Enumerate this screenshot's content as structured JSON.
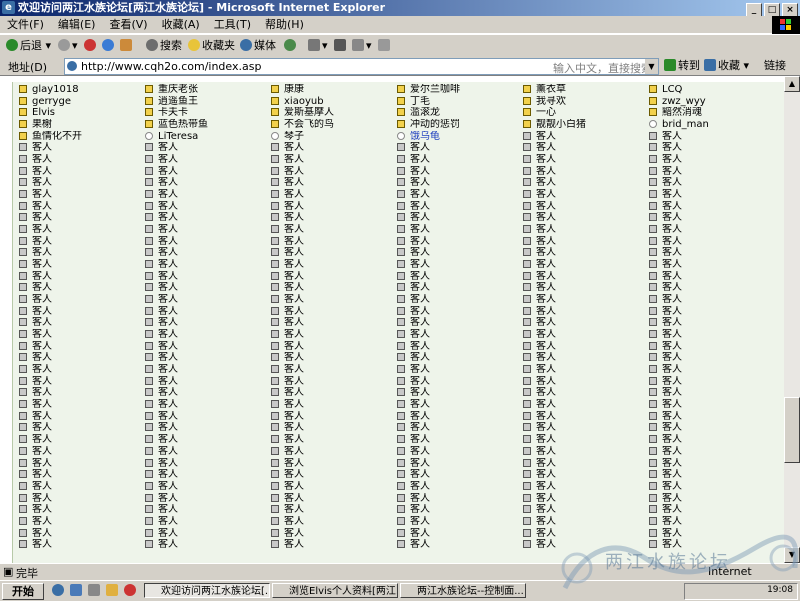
{
  "window": {
    "title": "欢迎访问两江水族论坛[两江水族论坛] - Microsoft Internet Explorer",
    "controls": [
      "_",
      "□",
      "×"
    ]
  },
  "menu": [
    "文件(F)",
    "编辑(E)",
    "查看(V)",
    "收藏(A)",
    "工具(T)",
    "帮助(H)"
  ],
  "toolbar": {
    "back": "后退",
    "search": "搜索",
    "favorites": "收藏夹",
    "media": "媒体"
  },
  "address": {
    "label": "地址(D)",
    "url": "http://www.cqh2o.com/index.asp",
    "search_hint": "输入中文，直接搜索",
    "go": "转到",
    "fav": "收藏",
    "links": "链接"
  },
  "users_named": [
    {
      "name": "glay1018",
      "icon": "member"
    },
    {
      "name": "重庆老张",
      "icon": "member"
    },
    {
      "name": "康康",
      "icon": "member"
    },
    {
      "name": "爱尔兰咖啡",
      "icon": "member"
    },
    {
      "name": "薰衣草",
      "icon": "member"
    },
    {
      "name": "LCQ",
      "icon": "member"
    },
    {
      "name": "gerryge",
      "icon": "member"
    },
    {
      "name": "逍遥鱼王",
      "icon": "member"
    },
    {
      "name": "xiaoyub",
      "icon": "member"
    },
    {
      "name": "丁毛",
      "icon": "member"
    },
    {
      "name": "我寻欢",
      "icon": "member"
    },
    {
      "name": "zwz_wyy",
      "icon": "member"
    },
    {
      "name": "Elvis",
      "icon": "member"
    },
    {
      "name": "卡夫卡",
      "icon": "member"
    },
    {
      "name": "爱斯基摩人",
      "icon": "member"
    },
    {
      "name": "滥滚龙",
      "icon": "member"
    },
    {
      "name": "一心",
      "icon": "member"
    },
    {
      "name": "黯然消魂",
      "icon": "member"
    },
    {
      "name": "果榭",
      "icon": "member"
    },
    {
      "name": "蓝色热带鱼",
      "icon": "member"
    },
    {
      "name": "不会飞的鸟",
      "icon": "member"
    },
    {
      "name": "冲动的惩罚",
      "icon": "member"
    },
    {
      "name": "靓靓小白猪",
      "icon": "member"
    },
    {
      "name": "brid_man",
      "icon": "web"
    },
    {
      "name": "鱼情化不开",
      "icon": "member"
    },
    {
      "name": "LiTeresa",
      "icon": "web"
    },
    {
      "name": "琴子",
      "icon": "web"
    },
    {
      "name": "饿乌龟",
      "icon": "web",
      "highlight": true
    },
    {
      "name": "客人",
      "icon": "guest"
    },
    {
      "name": "客人",
      "icon": "guest"
    }
  ],
  "guest_label": "客人",
  "guest_rows": 35,
  "status": {
    "text": "完毕",
    "zone": "Internet"
  },
  "taskbar": {
    "start": "开始",
    "tasks": [
      "欢迎访问两江水族论坛[...",
      "浏览Elvis个人资料[两江...",
      "两江水族论坛--控制面..."
    ],
    "clock": "19:08"
  },
  "watermark": "两江水族论坛"
}
